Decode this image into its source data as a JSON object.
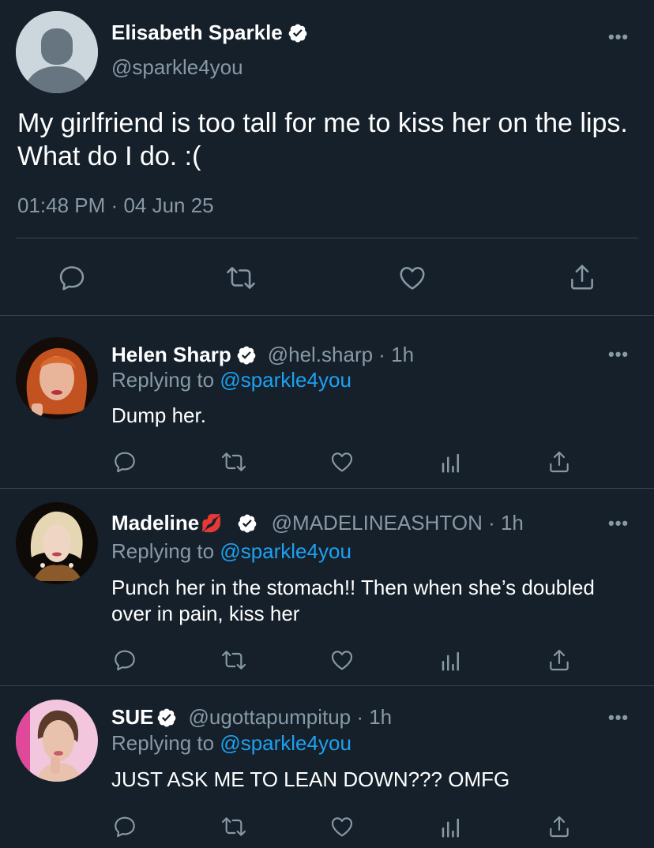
{
  "main_tweet": {
    "author_name": "Elisabeth Sparkle",
    "handle": "@sparkle4you",
    "text": "My girlfriend is too tall for me to kiss her on the lips. What do I do. :(",
    "time": "01:48 PM",
    "separator": "·",
    "date": "04 Jun 25",
    "more_label": "•••",
    "actions": [
      "reply-icon",
      "retweet-icon",
      "like-icon",
      "share-icon"
    ]
  },
  "replies": [
    {
      "name": "Helen Sharp",
      "handle": "@hel.sharp · 1h",
      "replying_prefix": "Replying to ",
      "replying_to": "@sparkle4you",
      "text": "Dump her.",
      "more_label": "•••"
    },
    {
      "name": "Madeline",
      "name_emoji": "💋",
      "handle": "@MADELINEASHTON · 1h",
      "replying_prefix": "Replying to ",
      "replying_to": "@sparkle4you",
      "text": "Punch her in the stomach!! Then when she’s doubled over in pain, kiss her",
      "more_label": "•••"
    },
    {
      "name": "SUE",
      "handle": "@ugottapumpitup · 1h",
      "replying_prefix": "Replying to ",
      "replying_to": "@sparkle4you",
      "text": "JUST ASK ME TO LEAN DOWN??? OMFG",
      "more_label": "•••"
    }
  ],
  "colors": {
    "background": "#15202b",
    "secondary_text": "#8899a6",
    "link": "#1da1f2",
    "divider": "#38444d"
  }
}
